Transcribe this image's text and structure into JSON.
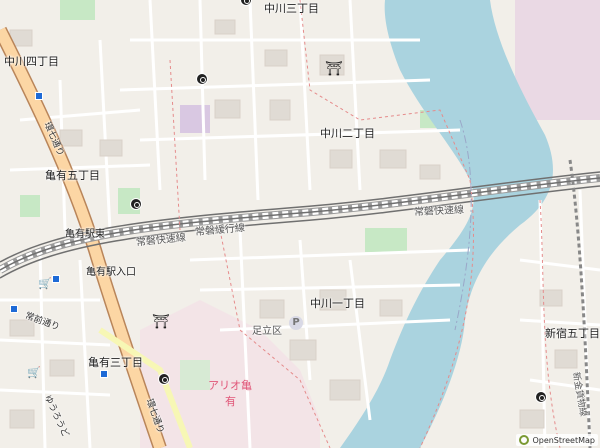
{
  "map": {
    "labels": {
      "nakagawa_3": "中川三丁目",
      "nakagawa_4": "中川四丁目",
      "nakagawa_2": "中川二丁目",
      "nakagawa_1": "中川一丁目",
      "kameari_5": "亀有五丁目",
      "kameari_3": "亀有三丁目",
      "shinjuku_5": "新宿五丁目",
      "kameari_station_east": "亀有駅東",
      "kameari_station_entrance": "亀有駅入口",
      "joban_rapid_w": "常磐快速線",
      "joban_slow": "常磐緩行線",
      "joban_rapid_e": "常磐快速線",
      "kannana_n": "環七通り",
      "kannana_s": "環七通り",
      "tsunemae": "常前通り",
      "yuuroudo": "ゆうろうど",
      "adachi_ward": "足立区",
      "ario_line1": "アリオ亀",
      "ario_line2": "有",
      "shinkanamachi": "新金貨物線"
    },
    "attribution": "OpenStreetMap"
  }
}
